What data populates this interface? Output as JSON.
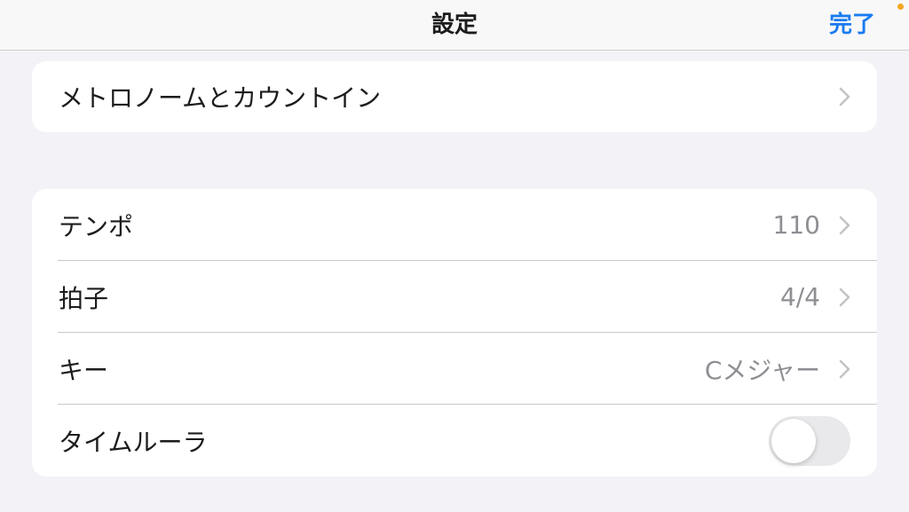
{
  "nav": {
    "title": "設定",
    "done_label": "完了"
  },
  "colors": {
    "accent": "#1a7cf0",
    "recording_indicator": "#f5a623",
    "toggle_off": "#e9e9eb"
  },
  "groups": [
    {
      "rows": [
        {
          "label": "メトロノームとカウントイン",
          "value": "",
          "accessory": "chevron-icon"
        }
      ]
    },
    {
      "rows": [
        {
          "label": "テンポ",
          "value": "110",
          "accessory": "chevron-icon"
        },
        {
          "label": "拍子",
          "value": "4/4",
          "accessory": "chevron-icon"
        },
        {
          "label": "キー",
          "value": "Cメジャー",
          "accessory": "chevron-icon"
        },
        {
          "label": "タイムルーラ",
          "accessory": "toggle",
          "toggle_on": false
        }
      ]
    }
  ]
}
